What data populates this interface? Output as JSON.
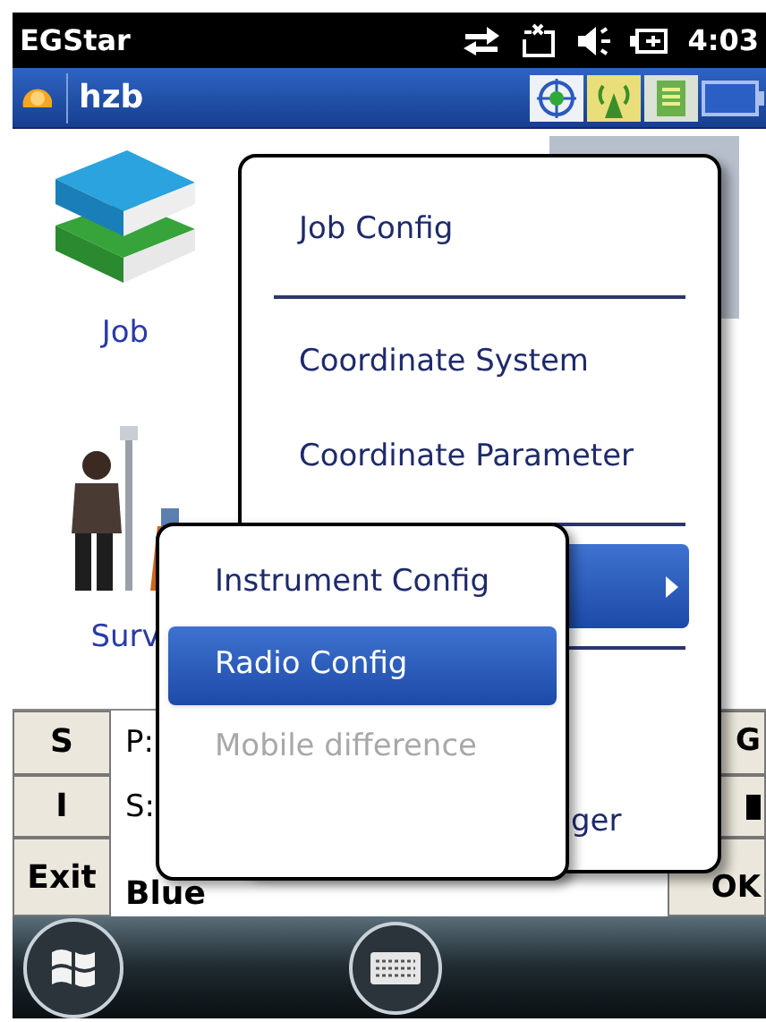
{
  "status_bar": {
    "app": "EGStar",
    "time": "4:03"
  },
  "title_bar": {
    "title": "hzb"
  },
  "launcher": [
    {
      "label": "Job",
      "kind": "books"
    },
    {
      "label": "Surv",
      "kind": "surveyor"
    }
  ],
  "info_panel": {
    "left_buttons": [
      "S",
      "I",
      "Exit"
    ],
    "lines": [
      "P:",
      "S:"
    ],
    "mode": "Blue",
    "right_buttons": [
      {
        "label": "G",
        "kind": "text"
      },
      {
        "kind": "mark"
      },
      {
        "label": "OK",
        "kind": "text"
      }
    ]
  },
  "menu": {
    "items": [
      {
        "kind": "item",
        "label": "Job Config",
        "selected": false
      },
      {
        "kind": "divider"
      },
      {
        "kind": "item",
        "label": "Coordinate System",
        "selected": false
      },
      {
        "kind": "item",
        "label": "Coordinate Parameter",
        "selected": false
      },
      {
        "kind": "divider"
      },
      {
        "kind": "submenu",
        "selected": true
      },
      {
        "kind": "divider"
      },
      {
        "kind": "covered",
        "label": "ger",
        "selected": false
      }
    ]
  },
  "submenu": {
    "items": [
      {
        "label": "Instrument Config",
        "selected": false,
        "disabled": false
      },
      {
        "label": "Radio Config",
        "selected": true,
        "disabled": false
      },
      {
        "label": "Mobile difference",
        "selected": false,
        "disabled": true
      }
    ]
  }
}
